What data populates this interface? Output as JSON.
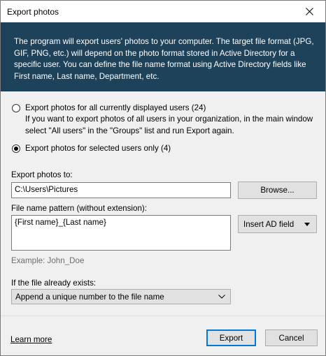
{
  "window": {
    "title": "Export photos"
  },
  "banner": {
    "text": "The program will export users' photos to your computer. The target file format (JPG, GIF, PNG, etc.) will depend on the photo format stored in Active Directory for a specific user. You can define the file name format using Active Directory fields like First name, Last name, Department, etc."
  },
  "options": {
    "all_users": {
      "label": "Export photos for all currently displayed users (24)",
      "hint": "If you want to export photos of all users in your organization, in the main window select \"All users\" in the \"Groups\" list and run Export again.",
      "checked": false
    },
    "selected_users": {
      "label": "Export photos for selected users only (4)",
      "checked": true
    }
  },
  "export_to": {
    "label": "Export photos to:",
    "value": "C:\\Users\\Pictures",
    "browse_label": "Browse..."
  },
  "pattern": {
    "label": "File name pattern (without extension):",
    "value": "{First name}_{Last name}",
    "insert_field_label": "Insert AD field",
    "example": "Example: John_Doe"
  },
  "exists": {
    "label": "If the file already exists:",
    "selected": "Append a unique number to the file name"
  },
  "footer": {
    "learn_more": "Learn more",
    "export_label": "Export",
    "cancel_label": "Cancel"
  },
  "colors": {
    "banner_bg": "#1e4259",
    "default_button_border": "#0078d7"
  },
  "icons": {
    "close": "close-icon",
    "dropdown": "chevron-down-icon"
  }
}
